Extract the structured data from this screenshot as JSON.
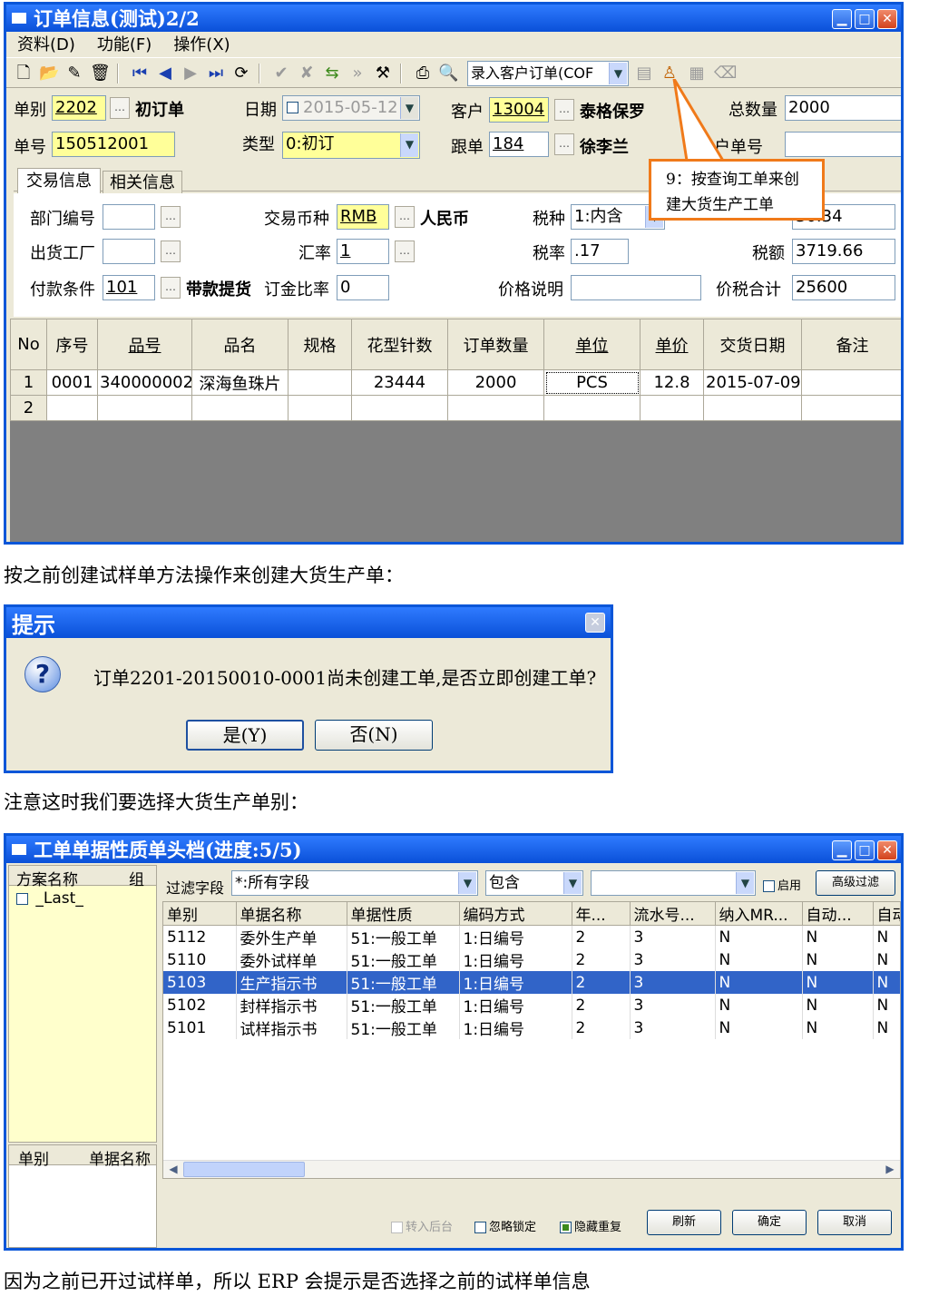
{
  "order_window": {
    "title": "订单信息(测试)2/2",
    "menu": [
      "资料(D)",
      "功能(F)",
      "操作(X)"
    ],
    "toolbar_combo": "录入客户订单(COF",
    "callout": {
      "line1": "9：按查询工单来创",
      "line2": "建大货生产工单"
    },
    "header": {
      "dan_bie_label": "单别",
      "dan_bie": "2202",
      "dan_bie_name": "初订单",
      "date_label": "日期",
      "date": "2015-05-12",
      "customer_label": "客户",
      "customer": "13004",
      "customer_name": "泰格保罗",
      "total_qty_label": "总数量",
      "total_qty": "2000",
      "dan_hao_label": "单号",
      "dan_hao": "150512001",
      "type_label": "类型",
      "type": "0:初订",
      "follower_label": "跟单",
      "follower": "184",
      "follower_name": "徐李兰",
      "cust_order_label": "户单号"
    },
    "tabs": [
      "交易信息",
      "相关信息"
    ],
    "trade": {
      "dept_label": "部门编号",
      "currency_label": "交易币种",
      "currency": "RMB",
      "currency_name": "人民币",
      "tax_type_label": "税种",
      "tax_type": "1:内含",
      "amount_partial": "30.34",
      "factory_label": "出货工厂",
      "rate_label": "汇率",
      "rate": "1",
      "tax_rate_label": "税率",
      "tax_rate": ".17",
      "tax_amount_label": "税额",
      "tax_amount": "3719.66",
      "pay_label": "付款条件",
      "pay": "101",
      "pay_name": "带款提货",
      "deposit_label": "订金比率",
      "deposit": "0",
      "price_note_label": "价格说明",
      "total_label": "价税合计",
      "total": "25600"
    },
    "grid": {
      "headers": [
        "No",
        "序号",
        "品号",
        "品名",
        "规格",
        "花型针数",
        "订单数量",
        "单位",
        "单价",
        "交货日期",
        "备注"
      ],
      "rows": [
        [
          "1",
          "0001",
          "340000002",
          "深海鱼珠片",
          "",
          "23444",
          "2000",
          "PCS",
          "12.8",
          "2015-07-09",
          ""
        ],
        [
          "2",
          "",
          "",
          "",
          "",
          "",
          "",
          "",
          "",
          "",
          ""
        ]
      ]
    }
  },
  "caption1": "按之前创建试样单方法操作来创建大货生产单：",
  "dialog": {
    "title": "提示",
    "message": "订单2201-20150010-0001尚未创建工单,是否立即创建工单?",
    "yes": "是(Y)",
    "no": "否(N)"
  },
  "caption2": "注意这时我们要选择大货生产单别：",
  "workorder_window": {
    "title": "工单单据性质单头档(进度:5/5)",
    "left_headers": [
      "方案名称",
      "组"
    ],
    "left_item": "_Last_",
    "left_bottom_headers": [
      "单别",
      "单据名称"
    ],
    "filter_label": "过滤字段",
    "filter_field": "*:所有字段",
    "filter_op": "包含",
    "enable_label": "启用",
    "advanced_label": "高级过滤",
    "headers": [
      "单别",
      "单据名称",
      "单据性质",
      "编码方式",
      "年...",
      "流水号...",
      "纳入MR...",
      "自动...",
      "自动"
    ],
    "rows": [
      [
        "5112",
        "委外生产单",
        "51:一般工单",
        "1:日编号",
        "2",
        "3",
        "N",
        "N",
        "N"
      ],
      [
        "5110",
        "委外试样单",
        "51:一般工单",
        "1:日编号",
        "2",
        "3",
        "N",
        "N",
        "N"
      ],
      [
        "5103",
        "生产指示书",
        "51:一般工单",
        "1:日编号",
        "2",
        "3",
        "N",
        "N",
        "N"
      ],
      [
        "5102",
        "封样指示书",
        "51:一般工单",
        "1:日编号",
        "2",
        "3",
        "N",
        "N",
        "N"
      ],
      [
        "5101",
        "试样指示书",
        "51:一般工单",
        "1:日编号",
        "2",
        "3",
        "N",
        "N",
        "N"
      ]
    ],
    "selected_row": 2,
    "bottom": {
      "to_background": "转入后台",
      "ignore_lock": "忽略锁定",
      "hide_dup": "隐藏重复",
      "refresh": "刷新",
      "ok": "确定",
      "cancel": "取消"
    }
  },
  "caption3": "因为之前已开过试样单，所以 ERP 会提示是否选择之前的试样单信息"
}
